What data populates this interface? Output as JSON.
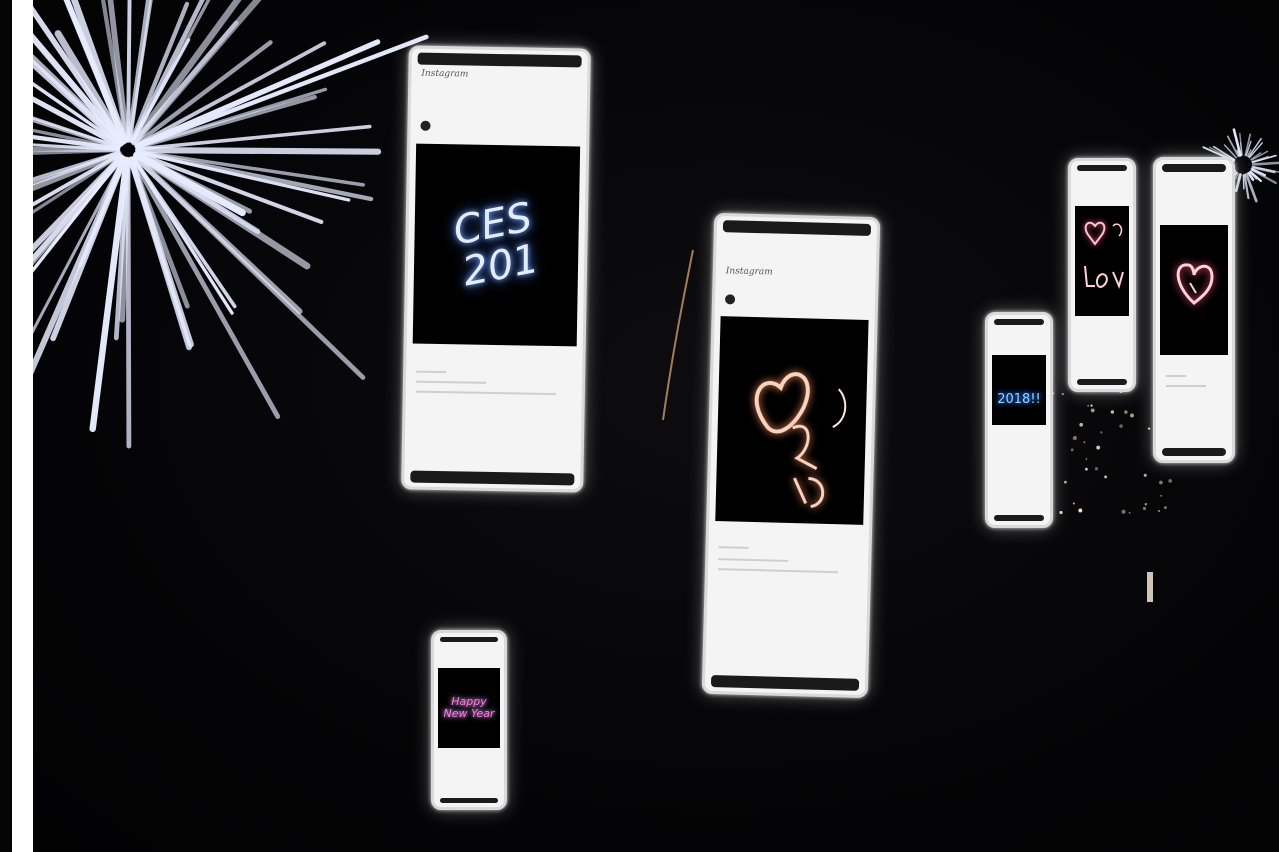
{
  "scene": {
    "background_color": "#050507",
    "border_color": "#ffffff",
    "firework_color": "#e8ecff"
  },
  "phones": [
    {
      "id": "phone-ces",
      "app": "Instagram",
      "post_text": "CES\n201",
      "post_color": "#dfe8ff",
      "post_glow": "#7fb0ff",
      "icon": "ces-handwriting"
    },
    {
      "id": "phone-heart-center",
      "app": "Instagram",
      "post_text": "",
      "post_color": "#f3c6b0",
      "post_glow": "#ff8a5a",
      "icon": "heart-sparkler"
    },
    {
      "id": "phone-2018",
      "app": "",
      "post_text": "2018!!",
      "post_color": "#7fd0ff",
      "post_glow": "#2f7bff",
      "icon": "heart-blue-sparkler"
    },
    {
      "id": "phone-love",
      "app": "",
      "post_text": "",
      "post_color": "#ffb3c8",
      "post_glow": "#ff5a8a",
      "icon": "love-sparkler"
    },
    {
      "id": "phone-heart-right",
      "app": "",
      "post_text": "",
      "post_color": "#ffd3dc",
      "post_glow": "#ff4f6f",
      "icon": "heart-red-sparkler"
    },
    {
      "id": "phone-newyear",
      "app": "",
      "post_text": "Happy\nNew Year",
      "post_color": "#ff6fd0",
      "post_glow": "#6fd8ff",
      "icon": "new-year-neon"
    }
  ]
}
